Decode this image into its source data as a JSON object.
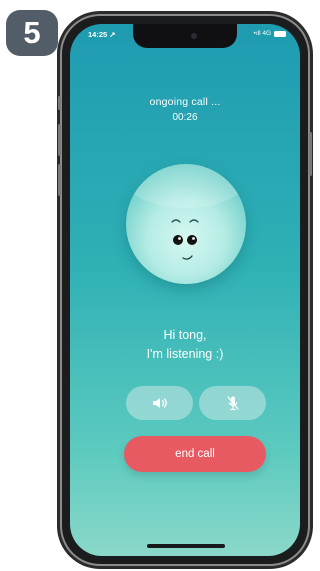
{
  "step_badge": "5",
  "status_bar": {
    "time": "14:25 ↗",
    "signal": "•ıll 4G"
  },
  "call": {
    "status": "ongoing call ...",
    "timer": "00:26"
  },
  "greeting": {
    "line1": "Hi tong,",
    "line2": "I'm listening :)"
  },
  "controls": {
    "speaker_icon": "speaker-icon",
    "mute_icon": "mic-off-icon",
    "end_call_label": "end call"
  },
  "colors": {
    "screen_top": "#1f9bb0",
    "screen_bottom": "#8ad8c9",
    "end_call": "#e85a62",
    "badge": "#535d67"
  }
}
